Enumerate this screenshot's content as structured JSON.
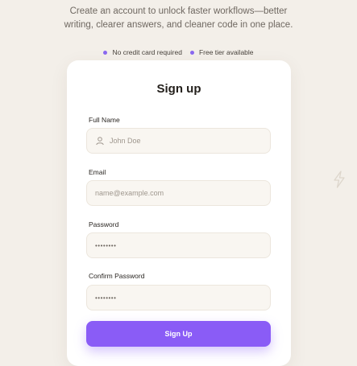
{
  "intro": {
    "line1": "Create an account to unlock faster workflows—better",
    "line2": "writing, clearer answers, and cleaner code in one place."
  },
  "perks": [
    {
      "label": "No credit card required"
    },
    {
      "label": "Free tier available"
    }
  ],
  "form": {
    "title": "Sign up",
    "full_name": {
      "label": "Full Name",
      "placeholder": "John Doe",
      "icon": "user-icon"
    },
    "email": {
      "label": "Email",
      "placeholder": "name@example.com"
    },
    "password": {
      "label": "Password",
      "value": "••••••••"
    },
    "confirm_password": {
      "label": "Confirm Password",
      "value": "••••••••"
    },
    "submit_label": "Sign Up"
  },
  "colors": {
    "accent": "#8a5cf6",
    "background": "#f3efe9"
  }
}
